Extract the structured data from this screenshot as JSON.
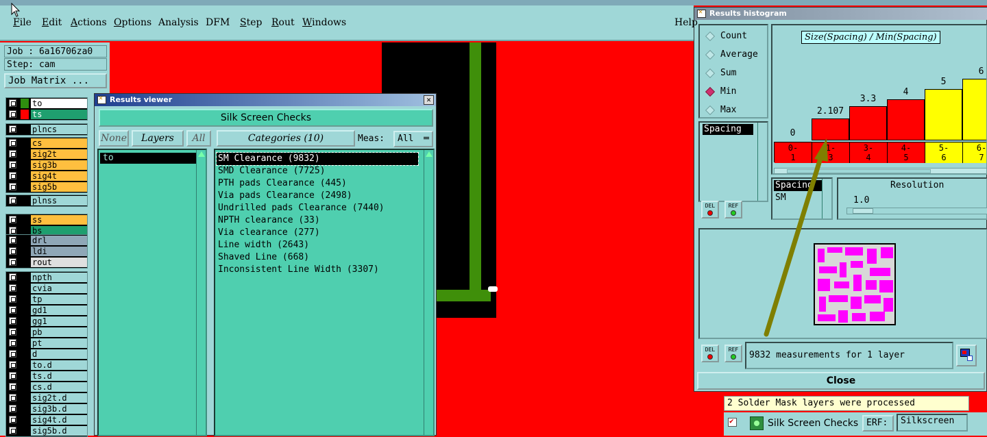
{
  "menu": {
    "items": [
      {
        "label": "File",
        "u": "F",
        "rest": "ile"
      },
      {
        "label": "Edit",
        "u": "E",
        "rest": "dit"
      },
      {
        "label": "Actions",
        "u": "A",
        "rest": "ctions"
      },
      {
        "label": "Options",
        "u": "O",
        "rest": "ptions"
      },
      {
        "label": "Analysis",
        "u": "",
        "rest": "Analysis"
      },
      {
        "label": "DFM",
        "u": "",
        "rest": "DFM"
      },
      {
        "label": "Step",
        "u": "S",
        "rest": "tep"
      },
      {
        "label": "Rout",
        "u": "R",
        "rest": "out"
      },
      {
        "label": "Windows",
        "u": "W",
        "rest": "indows"
      },
      {
        "label": "Help",
        "u": "",
        "rest": "Help"
      }
    ]
  },
  "job": {
    "job_label": "Job : 6a16706za0",
    "step_label": "Step: cam",
    "matrix_button": "Job Matrix ..."
  },
  "layers": {
    "group1": [
      {
        "name": "to",
        "sw": "#2f8f0f",
        "bg": "#ffffff"
      },
      {
        "name": "ts",
        "sw": "#ff0000",
        "bg": "#1f9f6f",
        "fg": "#ffffff"
      }
    ],
    "group2": [
      {
        "name": "plncs",
        "sw": "#000000",
        "bg": "#9fd7d7"
      }
    ],
    "group3": [
      {
        "name": "cs",
        "sw": "#000000",
        "bg": "#ffbf3f"
      },
      {
        "name": "sig2t",
        "sw": "#000000",
        "bg": "#ffbf3f"
      },
      {
        "name": "sig3b",
        "sw": "#000000",
        "bg": "#ffbf3f"
      },
      {
        "name": "sig4t",
        "sw": "#000000",
        "bg": "#ffbf3f"
      },
      {
        "name": "sig5b",
        "sw": "#000000",
        "bg": "#ffbf3f"
      }
    ],
    "group4": [
      {
        "name": "plnss",
        "sw": "#000000",
        "bg": "#9fd7d7"
      }
    ],
    "group5": [
      {
        "name": "ss",
        "sw": "#000000",
        "bg": "#ffbf3f"
      },
      {
        "name": "bs",
        "sw": "#000000",
        "bg": "#1f9f6f"
      }
    ],
    "group6": [
      {
        "name": "drl",
        "sw": "#000000",
        "bg": "#8fa7b7"
      },
      {
        "name": "ldi",
        "sw": "#000000",
        "bg": "#8fa7b7"
      },
      {
        "name": "rout",
        "sw": "#000000",
        "bg": "#dfdfdf"
      }
    ],
    "group7": [
      {
        "name": "npth",
        "sw": "#000000",
        "bg": "#9fd7d7"
      },
      {
        "name": "cvia",
        "sw": "#000000",
        "bg": "#9fd7d7"
      },
      {
        "name": "tp",
        "sw": "#000000",
        "bg": "#9fd7d7"
      },
      {
        "name": "gd1",
        "sw": "#000000",
        "bg": "#9fd7d7"
      },
      {
        "name": "gg1",
        "sw": "#000000",
        "bg": "#9fd7d7"
      },
      {
        "name": "pb",
        "sw": "#000000",
        "bg": "#9fd7d7"
      },
      {
        "name": "pt",
        "sw": "#000000",
        "bg": "#9fd7d7"
      },
      {
        "name": "d",
        "sw": "#000000",
        "bg": "#9fd7d7"
      },
      {
        "name": "to.d",
        "sw": "#000000",
        "bg": "#9fd7d7"
      },
      {
        "name": "ts.d",
        "sw": "#000000",
        "bg": "#9fd7d7"
      },
      {
        "name": "cs.d",
        "sw": "#000000",
        "bg": "#9fd7d7"
      },
      {
        "name": "sig2t.d",
        "sw": "#000000",
        "bg": "#9fd7d7"
      },
      {
        "name": "sig3b.d",
        "sw": "#000000",
        "bg": "#9fd7d7"
      },
      {
        "name": "sig4t.d",
        "sw": "#000000",
        "bg": "#9fd7d7"
      },
      {
        "name": "sig5b.d",
        "sw": "#000000",
        "bg": "#9fd7d7"
      }
    ]
  },
  "results_viewer": {
    "title": "Results viewer",
    "header_button": "Silk Screen Checks",
    "none_button": "None",
    "layers_button": "Layers",
    "all_button": "All",
    "categories_button": "Categories (10)",
    "meas_label": "Meas:",
    "meas_value": "All",
    "layer_list": [
      "to"
    ],
    "categories": [
      "SM Clearance (9832)",
      "SMD Clearance (7725)",
      "PTH pads Clearance (445)",
      "Via pads Clearance (2498)",
      "Undrilled pads Clearance (7440)",
      "NPTH clearance (33)",
      "Via clearance (277)",
      "Line width (2643)",
      "Shaved Line (668)",
      "Inconsistent Line Width (3307)"
    ]
  },
  "histogram": {
    "title": "Results histogram",
    "modes": [
      {
        "label": "Count",
        "selected": false
      },
      {
        "label": "Average",
        "selected": false
      },
      {
        "label": "Sum",
        "selected": false
      },
      {
        "label": "Min",
        "selected": true
      },
      {
        "label": "Max",
        "selected": false
      }
    ],
    "field_list": [
      "Spacing"
    ],
    "plot_title": "Size(Spacing) / Min(Spacing)",
    "bars": [
      {
        "value": "0",
        "bin": "0-\n1",
        "height": 0,
        "color": "#ff0000"
      },
      {
        "value": "2.107",
        "bin": "1-\n3",
        "height": 2.107,
        "color": "#ff0000"
      },
      {
        "value": "3.3",
        "bin": "3-\n4",
        "height": 3.3,
        "color": "#ff0000"
      },
      {
        "value": "4",
        "bin": "4-\n5",
        "height": 4,
        "color": "#ff0000"
      },
      {
        "value": "5",
        "bin": "5-\n6",
        "height": 5,
        "color": "#ffff00"
      },
      {
        "value": "6",
        "bin": "6-\n7",
        "height": 6,
        "color": "#ffff00"
      }
    ],
    "del_label": "DEL",
    "ref_label": "REF",
    "spacing_list": [
      "Spacing",
      "SM"
    ],
    "resolution_label": "Resolution",
    "resolution_value": "1.0",
    "measurements": "9832 measurements for 1 layer",
    "close_button": "Close"
  },
  "status": {
    "message": "2 Solder Mask layers were processed",
    "check_name": "Silk Screen Checks",
    "erf_label": "ERF:",
    "erf_value": "Silkscreen"
  }
}
